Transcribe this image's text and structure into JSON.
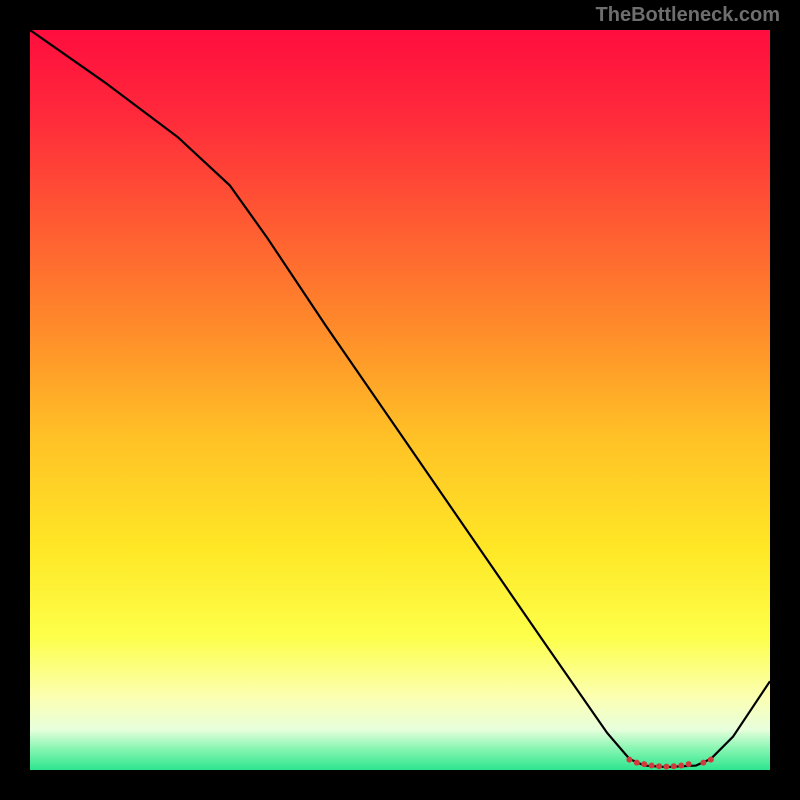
{
  "watermark": "TheBottleneck.com",
  "chart_data": {
    "type": "line",
    "title": "",
    "xlabel": "",
    "ylabel": "",
    "xlim": [
      0,
      100
    ],
    "ylim": [
      0,
      100
    ],
    "background_gradient": {
      "stops": [
        {
          "offset": 0.0,
          "color": "#ff0d3e"
        },
        {
          "offset": 0.12,
          "color": "#ff2b3b"
        },
        {
          "offset": 0.25,
          "color": "#ff5733"
        },
        {
          "offset": 0.4,
          "color": "#ff8a2a"
        },
        {
          "offset": 0.55,
          "color": "#ffc126"
        },
        {
          "offset": 0.7,
          "color": "#ffe726"
        },
        {
          "offset": 0.82,
          "color": "#fdff4a"
        },
        {
          "offset": 0.9,
          "color": "#fcffb0"
        },
        {
          "offset": 0.945,
          "color": "#e8ffdc"
        },
        {
          "offset": 0.97,
          "color": "#8cf6b4"
        },
        {
          "offset": 1.0,
          "color": "#2de58e"
        }
      ]
    },
    "series": [
      {
        "name": "curve",
        "color": "#000000",
        "width": 2.2,
        "points": [
          {
            "x": 0,
            "y": 100.0
          },
          {
            "x": 10,
            "y": 93.0
          },
          {
            "x": 20,
            "y": 85.5
          },
          {
            "x": 27,
            "y": 79.0
          },
          {
            "x": 32,
            "y": 72.0
          },
          {
            "x": 40,
            "y": 60.0
          },
          {
            "x": 50,
            "y": 45.5
          },
          {
            "x": 60,
            "y": 31.0
          },
          {
            "x": 70,
            "y": 16.5
          },
          {
            "x": 78,
            "y": 5.0
          },
          {
            "x": 81,
            "y": 1.5
          },
          {
            "x": 83,
            "y": 0.6
          },
          {
            "x": 86,
            "y": 0.4
          },
          {
            "x": 90,
            "y": 0.6
          },
          {
            "x": 92,
            "y": 1.5
          },
          {
            "x": 95,
            "y": 4.5
          },
          {
            "x": 100,
            "y": 12.0
          }
        ]
      }
    ],
    "markers": {
      "name": "highlight-dots",
      "color": "#d23b3b",
      "radius_px": 3,
      "points": [
        {
          "x": 81.0,
          "y": 1.4
        },
        {
          "x": 82.0,
          "y": 1.0
        },
        {
          "x": 83.0,
          "y": 0.8
        },
        {
          "x": 84.0,
          "y": 0.6
        },
        {
          "x": 85.0,
          "y": 0.5
        },
        {
          "x": 86.0,
          "y": 0.45
        },
        {
          "x": 87.0,
          "y": 0.5
        },
        {
          "x": 88.0,
          "y": 0.6
        },
        {
          "x": 89.0,
          "y": 0.8
        },
        {
          "x": 91.0,
          "y": 1.0
        },
        {
          "x": 92.0,
          "y": 1.4
        }
      ]
    }
  }
}
